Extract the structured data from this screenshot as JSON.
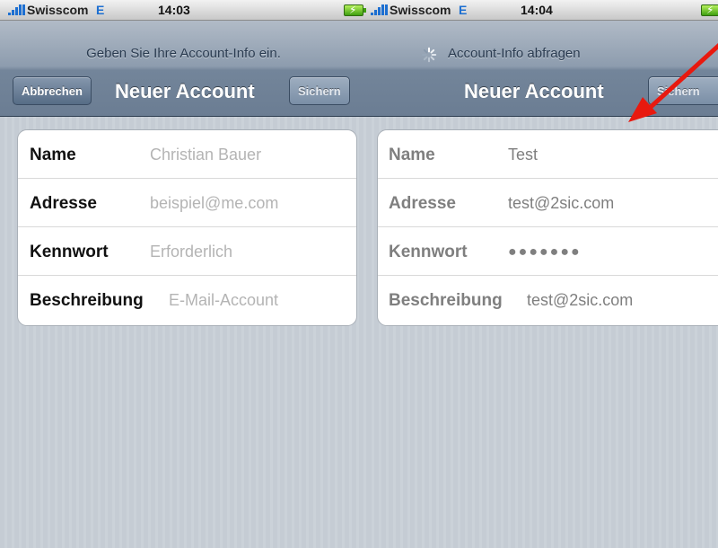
{
  "left": {
    "status": {
      "carrier": "Swisscom",
      "network": "E",
      "time": "14:03"
    },
    "nav": {
      "prompt": "Geben Sie Ihre Account-Info ein.",
      "title": "Neuer Account",
      "cancel_label": "Abbrechen",
      "save_label": "Sichern"
    },
    "form": {
      "rows": [
        {
          "label": "Name",
          "value": "Christian Bauer"
        },
        {
          "label": "Adresse",
          "value": "beispiel@me.com"
        },
        {
          "label": "Kennwort",
          "value": "Erforderlich"
        },
        {
          "label": "Beschreibung",
          "value": "E-Mail-Account"
        }
      ]
    }
  },
  "right": {
    "status": {
      "carrier": "Swisscom",
      "network": "E",
      "time": "14:04"
    },
    "nav": {
      "prompt": "Account-Info abfragen",
      "title": "Neuer Account",
      "save_label": "Sichern"
    },
    "form": {
      "rows": [
        {
          "label": "Name",
          "value": "Test"
        },
        {
          "label": "Adresse",
          "value": "test@2sic.com"
        },
        {
          "label": "Kennwort",
          "value": "●●●●●●●"
        },
        {
          "label": "Beschreibung",
          "value": "test@2sic.com"
        }
      ]
    }
  },
  "annotation": {
    "arrow_color": "#e8190f"
  },
  "colors": {
    "nav_accent": "#6b7d93",
    "network_blue": "#1d6fd1"
  }
}
